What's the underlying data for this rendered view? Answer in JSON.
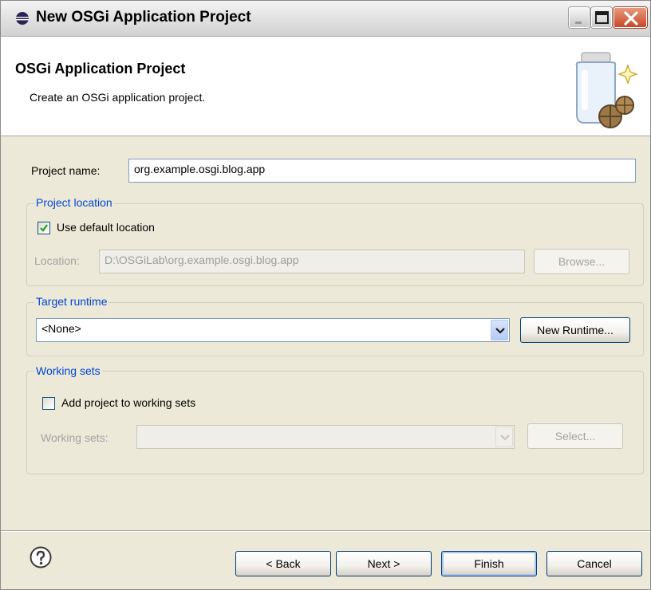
{
  "window": {
    "title": "New OSGi Application Project"
  },
  "banner": {
    "heading": "OSGi Application Project",
    "description": "Create an OSGi application project."
  },
  "project_name": {
    "label": "Project name:",
    "value": "org.example.osgi.blog.app"
  },
  "project_location": {
    "group_title": "Project location",
    "use_default_label": "Use default location",
    "use_default_checked": true,
    "location_label": "Location:",
    "location_value": "D:\\OSGiLab\\org.example.osgi.blog.app",
    "browse_label": "Browse..."
  },
  "target_runtime": {
    "group_title": "Target runtime",
    "selected": "<None>",
    "new_runtime_label": "New Runtime..."
  },
  "working_sets": {
    "group_title": "Working sets",
    "add_label": "Add project to working sets",
    "add_checked": false,
    "sets_label": "Working sets:",
    "sets_value": "",
    "select_label": "Select..."
  },
  "footer": {
    "help_icon": "help-icon",
    "back_label": "< Back",
    "next_label": "Next >",
    "finish_label": "Finish",
    "cancel_label": "Cancel"
  },
  "colors": {
    "dialog_bg": "#ece9d8",
    "group_title": "#0046d5",
    "close_button": "#c8472a"
  }
}
